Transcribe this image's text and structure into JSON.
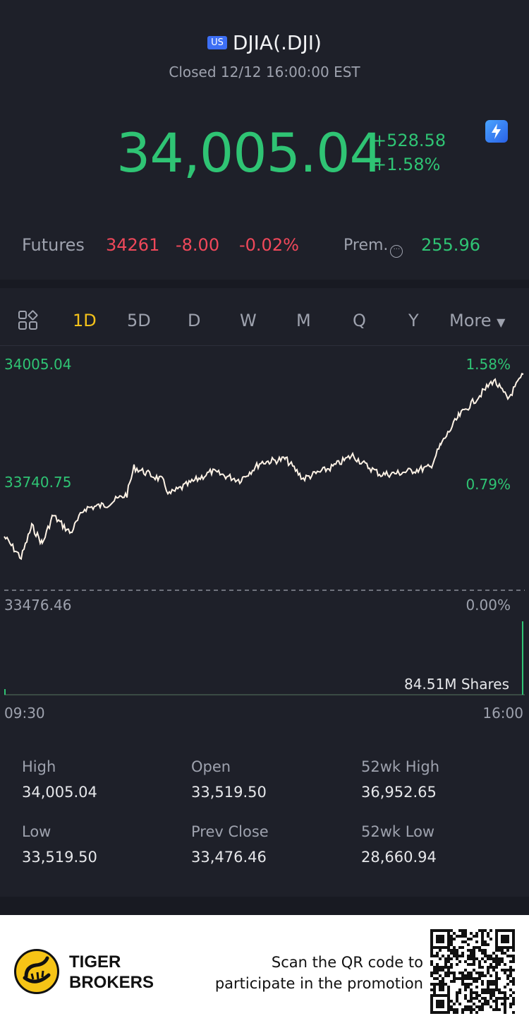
{
  "header": {
    "market_badge": "US",
    "title": "DJIA(.DJI)",
    "status": "Closed 12/12 16:00:00 EST",
    "price": "34,005.04",
    "change_abs": "+528.58",
    "change_pct": "+1.58%"
  },
  "futures": {
    "label": "Futures",
    "value": "34261",
    "change": "-8.00",
    "change_pct": "-0.02%",
    "prem_label": "Prem.",
    "prem_value": "255.96"
  },
  "tabs": {
    "items": [
      "1D",
      "5D",
      "D",
      "W",
      "M",
      "Q",
      "Y"
    ],
    "active": "1D",
    "more_label": "More"
  },
  "chart_data": {
    "type": "line",
    "y_axis_left": [
      "34005.04",
      "33740.75",
      "33476.46"
    ],
    "y_axis_right": [
      "1.58%",
      "0.79%",
      "0.00%"
    ],
    "x_labels": [
      "09:30",
      "16:00"
    ],
    "ylim": [
      33476.46,
      34005.04
    ],
    "volume_label": "84.51M Shares",
    "line_color": "#fff3e6"
  },
  "stats": {
    "high_label": "High",
    "high": "34,005.04",
    "open_label": "Open",
    "open": "33,519.50",
    "wk52_high_label": "52wk High",
    "wk52_high": "36,952.65",
    "low_label": "Low",
    "low": "33,519.50",
    "prev_close_label": "Prev Close",
    "prev_close": "33,476.46",
    "wk52_low_label": "52wk Low",
    "wk52_low": "28,660.94"
  },
  "footer": {
    "brand_line1": "TIGER",
    "brand_line2": "BROKERS",
    "scan_line1": "Scan the QR code to",
    "scan_line2": "participate in the promotion"
  },
  "colors": {
    "up": "#2fc474",
    "down": "#f0485a",
    "accent": "#f4c21a",
    "background": "#1e2029"
  }
}
